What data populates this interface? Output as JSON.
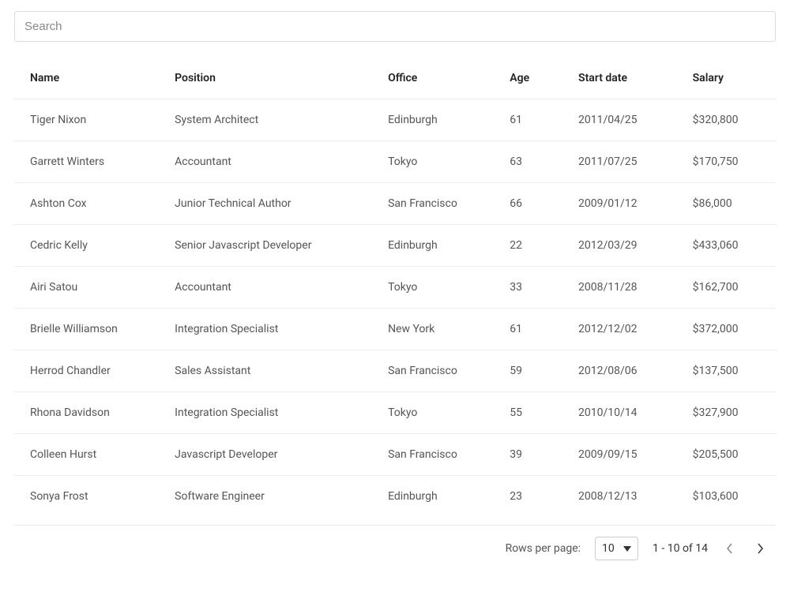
{
  "search": {
    "placeholder": "Search",
    "value": ""
  },
  "table": {
    "columns": [
      "Name",
      "Position",
      "Office",
      "Age",
      "Start date",
      "Salary"
    ],
    "rows": [
      {
        "name": "Tiger Nixon",
        "position": "System Architect",
        "office": "Edinburgh",
        "age": "61",
        "start_date": "2011/04/25",
        "salary": "$320,800"
      },
      {
        "name": "Garrett Winters",
        "position": "Accountant",
        "office": "Tokyo",
        "age": "63",
        "start_date": "2011/07/25",
        "salary": "$170,750"
      },
      {
        "name": "Ashton Cox",
        "position": "Junior Technical Author",
        "office": "San Francisco",
        "age": "66",
        "start_date": "2009/01/12",
        "salary": "$86,000"
      },
      {
        "name": "Cedric Kelly",
        "position": "Senior Javascript Developer",
        "office": "Edinburgh",
        "age": "22",
        "start_date": "2012/03/29",
        "salary": "$433,060"
      },
      {
        "name": "Airi Satou",
        "position": "Accountant",
        "office": "Tokyo",
        "age": "33",
        "start_date": "2008/11/28",
        "salary": "$162,700"
      },
      {
        "name": "Brielle Williamson",
        "position": "Integration Specialist",
        "office": "New York",
        "age": "61",
        "start_date": "2012/12/02",
        "salary": "$372,000"
      },
      {
        "name": "Herrod Chandler",
        "position": "Sales Assistant",
        "office": "San Francisco",
        "age": "59",
        "start_date": "2012/08/06",
        "salary": "$137,500"
      },
      {
        "name": "Rhona Davidson",
        "position": "Integration Specialist",
        "office": "Tokyo",
        "age": "55",
        "start_date": "2010/10/14",
        "salary": "$327,900"
      },
      {
        "name": "Colleen Hurst",
        "position": "Javascript Developer",
        "office": "San Francisco",
        "age": "39",
        "start_date": "2009/09/15",
        "salary": "$205,500"
      },
      {
        "name": "Sonya Frost",
        "position": "Software Engineer",
        "office": "Edinburgh",
        "age": "23",
        "start_date": "2008/12/13",
        "salary": "$103,600"
      }
    ]
  },
  "pagination": {
    "rows_per_page_label": "Rows per page:",
    "rows_per_page_value": "10",
    "range_info": "1 - 10 of 14"
  }
}
